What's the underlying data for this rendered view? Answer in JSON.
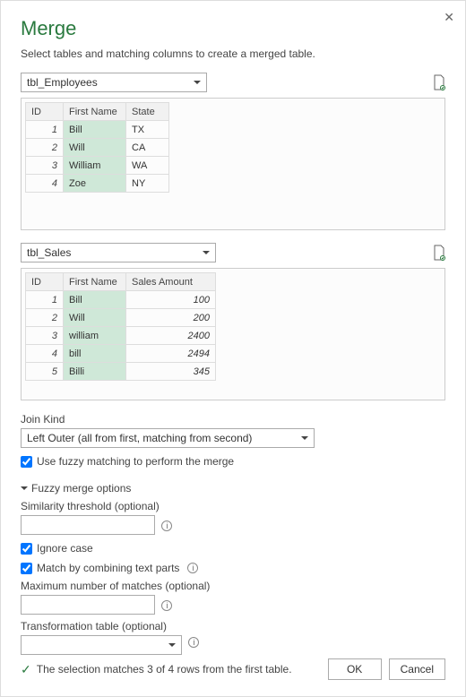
{
  "title": "Merge",
  "subtitle": "Select tables and matching columns to create a merged table.",
  "table1": {
    "name": "tbl_Employees",
    "columns": [
      "ID",
      "First Name",
      "State"
    ],
    "rows": [
      {
        "id": "1",
        "fn": "Bill",
        "v": "TX"
      },
      {
        "id": "2",
        "fn": "Will",
        "v": "CA"
      },
      {
        "id": "3",
        "fn": "William",
        "v": "WA"
      },
      {
        "id": "4",
        "fn": "Zoe",
        "v": "NY"
      }
    ]
  },
  "table2": {
    "name": "tbl_Sales",
    "columns": [
      "ID",
      "First Name",
      "Sales Amount"
    ],
    "rows": [
      {
        "id": "1",
        "fn": "Bill",
        "v": "100"
      },
      {
        "id": "2",
        "fn": "Will",
        "v": "200"
      },
      {
        "id": "3",
        "fn": "william",
        "v": "2400"
      },
      {
        "id": "4",
        "fn": "bill",
        "v": "2494"
      },
      {
        "id": "5",
        "fn": "Billi",
        "v": "345"
      }
    ]
  },
  "join": {
    "label": "Join Kind",
    "value": "Left Outer (all from first, matching from second)"
  },
  "fuzzy": {
    "use_label": "Use fuzzy matching to perform the merge",
    "use_checked": true,
    "section_label": "Fuzzy merge options",
    "sim_label": "Similarity threshold (optional)",
    "sim_value": "",
    "ignore_case_label": "Ignore case",
    "ignore_case_checked": true,
    "combine_label": "Match by combining text parts",
    "combine_checked": true,
    "max_label": "Maximum number of matches (optional)",
    "max_value": "",
    "trans_label": "Transformation table (optional)",
    "trans_value": ""
  },
  "status": "The selection matches 3 of 4 rows from the first table.",
  "buttons": {
    "ok": "OK",
    "cancel": "Cancel"
  }
}
